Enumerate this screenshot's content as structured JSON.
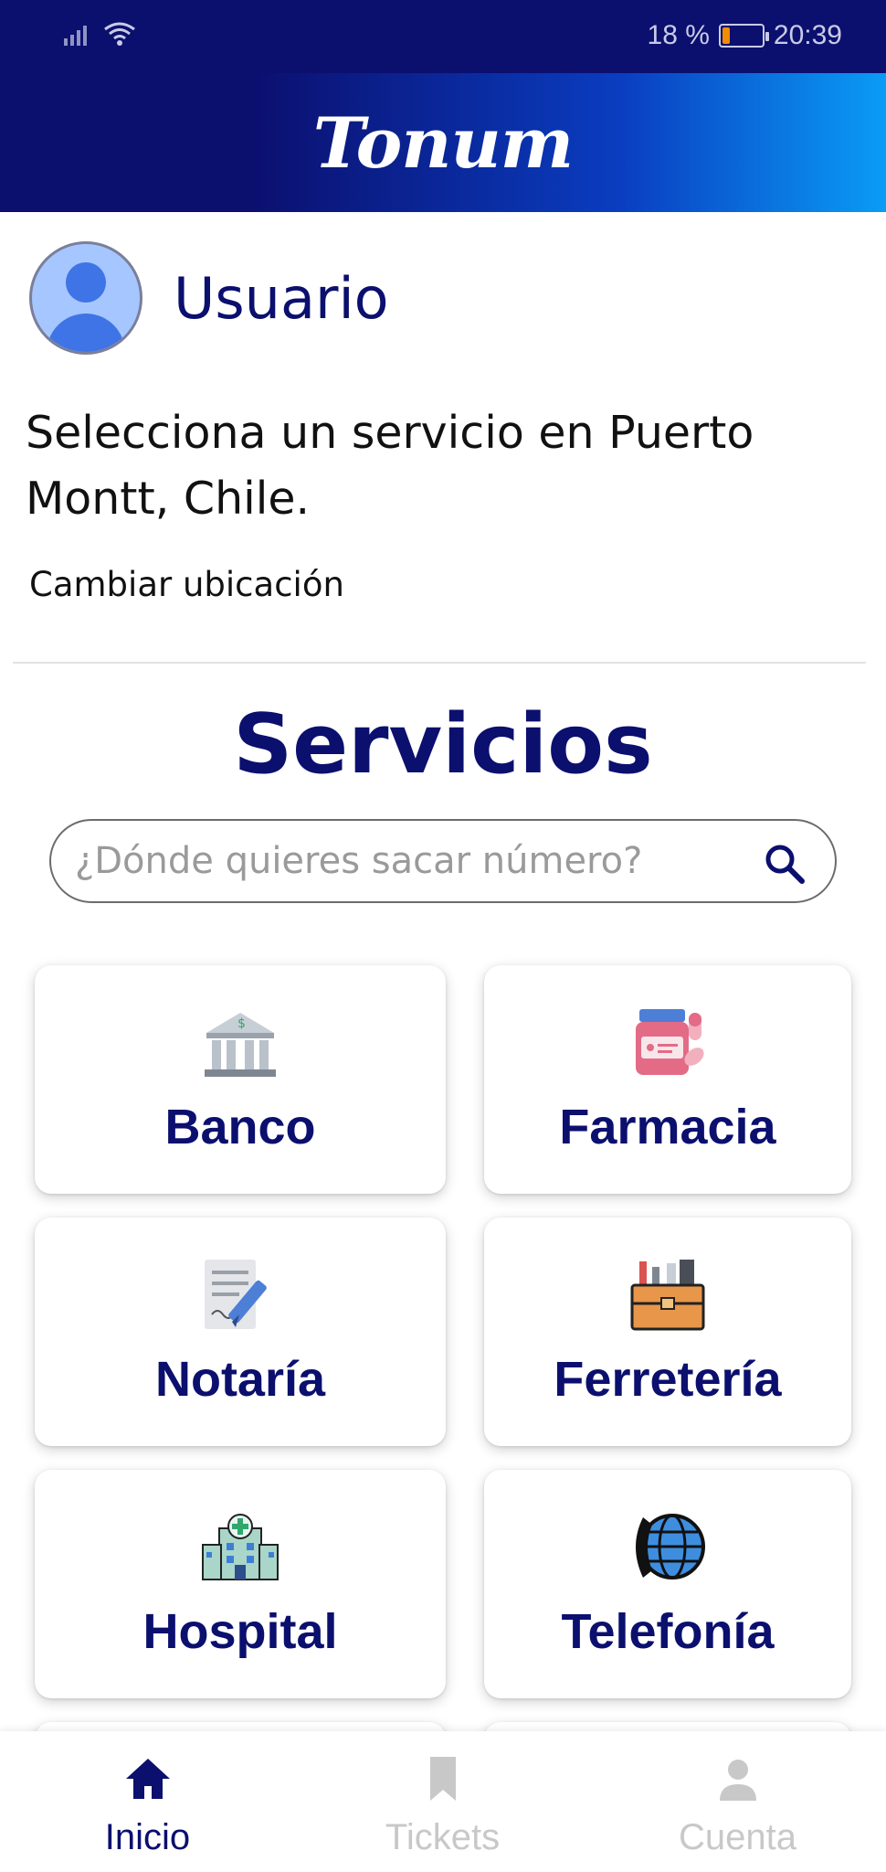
{
  "status_bar": {
    "battery_percent": "18 %",
    "time": "20:39",
    "battery_level": 0.18
  },
  "header": {
    "app_name": "Tonum"
  },
  "user": {
    "name": "Usuario"
  },
  "location": {
    "prompt": "Selecciona un servicio en Puerto Montt, Chile.",
    "change_label": "Cambiar ubicación"
  },
  "services": {
    "title": "Servicios",
    "search_placeholder": "¿Dónde quieres sacar número?",
    "items": [
      {
        "label": "Banco",
        "icon": "bank-icon"
      },
      {
        "label": "Farmacia",
        "icon": "pharmacy-icon"
      },
      {
        "label": "Notaría",
        "icon": "notary-icon"
      },
      {
        "label": "Ferretería",
        "icon": "toolbox-icon"
      },
      {
        "label": "Hospital",
        "icon": "hospital-icon"
      },
      {
        "label": "Telefonía",
        "icon": "phone-globe-icon"
      }
    ]
  },
  "bottom_nav": {
    "items": [
      {
        "label": "Inicio",
        "icon": "home-icon",
        "active": true
      },
      {
        "label": "Tickets",
        "icon": "bookmark-icon",
        "active": false
      },
      {
        "label": "Cuenta",
        "icon": "person-icon",
        "active": false
      }
    ]
  },
  "colors": {
    "primary": "#0b0f6e",
    "accent": "#0a9cf6",
    "avatar": "#3f74e6"
  }
}
